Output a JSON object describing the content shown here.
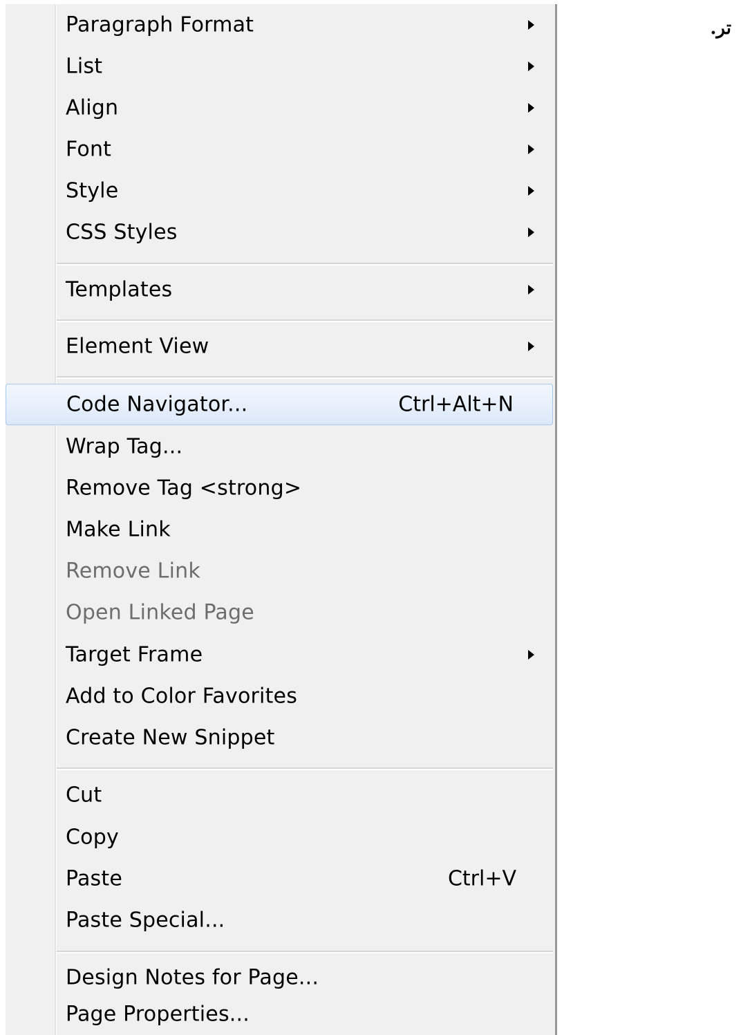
{
  "background": {
    "rtl_text": "تر."
  },
  "menu": {
    "items": [
      {
        "id": "paragraph-format",
        "label": "Paragraph Format",
        "submenu": true
      },
      {
        "id": "list",
        "label": "List",
        "submenu": true
      },
      {
        "id": "align",
        "label": "Align",
        "submenu": true
      },
      {
        "id": "font",
        "label": "Font",
        "submenu": true
      },
      {
        "id": "style",
        "label": "Style",
        "submenu": true
      },
      {
        "id": "css-styles",
        "label": "CSS Styles",
        "submenu": true
      },
      {
        "id": "templates",
        "label": "Templates",
        "submenu": true
      },
      {
        "id": "element-view",
        "label": "Element View",
        "submenu": true
      },
      {
        "id": "code-navigator",
        "label": "Code Navigator...",
        "shortcut": "Ctrl+Alt+N",
        "highlighted": true
      },
      {
        "id": "wrap-tag",
        "label": "Wrap Tag..."
      },
      {
        "id": "remove-tag",
        "label": "Remove Tag <strong>"
      },
      {
        "id": "make-link",
        "label": "Make Link"
      },
      {
        "id": "remove-link",
        "label": "Remove Link",
        "disabled": true
      },
      {
        "id": "open-linked-page",
        "label": "Open Linked Page",
        "disabled": true
      },
      {
        "id": "target-frame",
        "label": "Target Frame",
        "submenu": true
      },
      {
        "id": "add-to-color-favorites",
        "label": "Add to Color Favorites"
      },
      {
        "id": "create-new-snippet",
        "label": "Create New Snippet"
      },
      {
        "id": "cut",
        "label": "Cut"
      },
      {
        "id": "copy",
        "label": "Copy"
      },
      {
        "id": "paste",
        "label": "Paste",
        "shortcut": "Ctrl+V"
      },
      {
        "id": "paste-special",
        "label": "Paste Special..."
      },
      {
        "id": "design-notes",
        "label": "Design Notes for Page..."
      },
      {
        "id": "page-properties",
        "label": "Page Properties..."
      }
    ]
  },
  "colors": {
    "menu_background": "#f0f0f0",
    "highlight_border": "#a8c8ef",
    "disabled_text": "#6d6d6d"
  }
}
